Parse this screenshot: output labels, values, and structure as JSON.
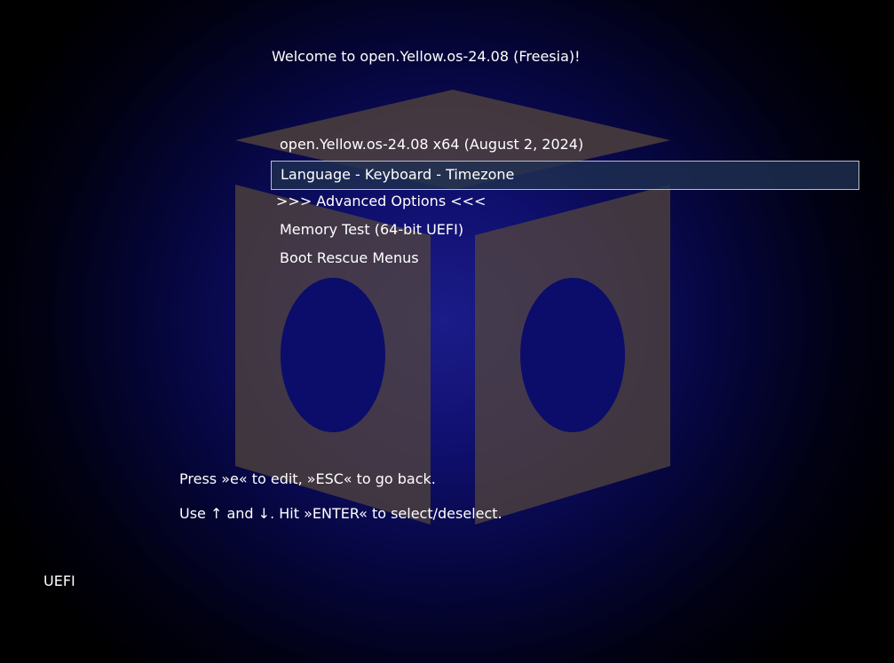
{
  "header": {
    "welcome_text": "Welcome to open.Yellow.os-24.08 (Freesia)!"
  },
  "menu": {
    "items": [
      {
        "label": "open.Yellow.os-24.08 x64 (August 2, 2024)",
        "selected": false
      },
      {
        "label": "Language - Keyboard - Timezone",
        "selected": true
      },
      {
        "label": ">>> Advanced Options <<<",
        "selected": false
      },
      {
        "label": "Memory Test (64-bit UEFI)",
        "selected": false
      },
      {
        "label": "Boot Rescue Menus",
        "selected": false
      }
    ]
  },
  "hints": {
    "edit_hint": "Press »e« to edit, »ESC« to go back.",
    "nav_hint": "Use ↑ and ↓. Hit »ENTER« to select/deselect."
  },
  "footer": {
    "boot_mode": "UEFI"
  },
  "colors": {
    "text": "#ffffff",
    "selection_border": "#b6bcd0",
    "selection_fill": "#1e3050",
    "logo_fill": "#56483a",
    "background_center": "#1c1c8a"
  },
  "icons": {
    "background_logo": "cube-logo-icon"
  }
}
